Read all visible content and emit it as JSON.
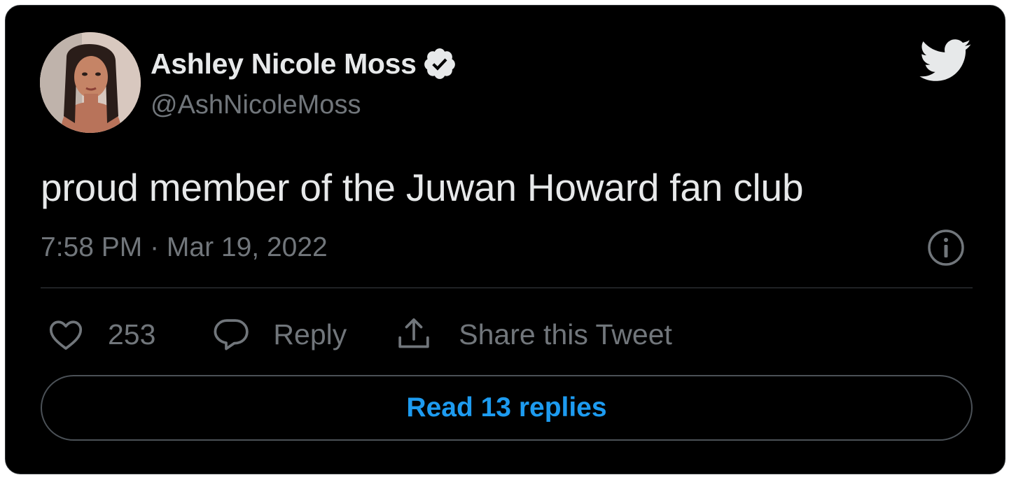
{
  "author": {
    "name": "Ashley Nicole Moss",
    "handle": "@AshNicoleMoss",
    "verified": true
  },
  "tweet": {
    "text": "proud member of the Juwan Howard fan club",
    "timestamp": "7:58 PM · Mar 19, 2022"
  },
  "actions": {
    "like_count": "253",
    "reply_label": "Reply",
    "share_label": "Share this Tweet"
  },
  "read_replies_label": "Read 13 replies",
  "icons": {
    "brand": "twitter-bird-icon",
    "verified": "verified-badge-icon",
    "info": "info-icon",
    "like": "heart-icon",
    "reply": "speech-bubble-icon",
    "share": "share-upload-icon"
  },
  "colors": {
    "background": "#000000",
    "text_primary": "#e7e9ea",
    "text_secondary": "#71767b",
    "accent": "#1d9bf0",
    "border": "#2f3336"
  }
}
